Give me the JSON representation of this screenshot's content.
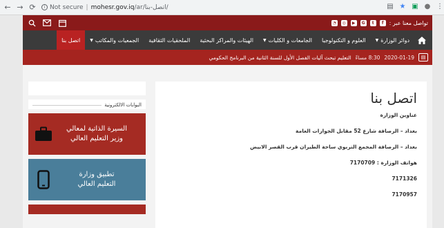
{
  "browser": {
    "not_secure": "Not secure",
    "host": "mohesr.gov.iq",
    "path": "/ar/اتصل-بنا/"
  },
  "topbar": {
    "contact_label": "تواصل معنا عبر :"
  },
  "nav": {
    "items": [
      {
        "label": "دوائر الوزارة",
        "dropdown": true
      },
      {
        "label": "العلوم و التكنولوجيا",
        "dropdown": false
      },
      {
        "label": "الجامعات و الكليات",
        "dropdown": true
      },
      {
        "label": "الهيئات والمراكز البحثية",
        "dropdown": false
      },
      {
        "label": "الملحقيات الثقافية",
        "dropdown": false
      },
      {
        "label": "الجمعيات والمكاتب",
        "dropdown": true
      },
      {
        "label": "اتصل بنا",
        "dropdown": false,
        "active": true
      }
    ]
  },
  "ticker": {
    "date": "2020-01-19",
    "time": "8:30 مساءً",
    "headline": "التعليم تبحث آليات الفصل الأول للسنة الثانية من البرنامج الحكومي"
  },
  "sidebar": {
    "portals_title": "البوابات الالكترونية",
    "tiles": [
      {
        "label_line1": "السيرة الذاتية لمعالي",
        "label_line2": "وزير التعليم العالي",
        "color": "#a52b23"
      },
      {
        "label_line1": "تطبيق وزارة",
        "label_line2": "التعليم العالي",
        "color": "#4a7e9a"
      }
    ]
  },
  "main": {
    "title": "اتصل بنا",
    "lines": [
      "عناوين الوزارة",
      "بغداد – الرصافة شارع 52 مقابل الجوازات العامة",
      "بغداد – الرصافة المجمع التربوي ساحة الطيران قرب القصر الابيض",
      "هواتف الوزارة : 7170709",
      "7171326",
      "7170957"
    ]
  },
  "colors": {
    "topbar": "#8a1a1a",
    "nav": "#3b3b3b",
    "nav_active": "#b92222",
    "ticker": "#a5241f"
  }
}
